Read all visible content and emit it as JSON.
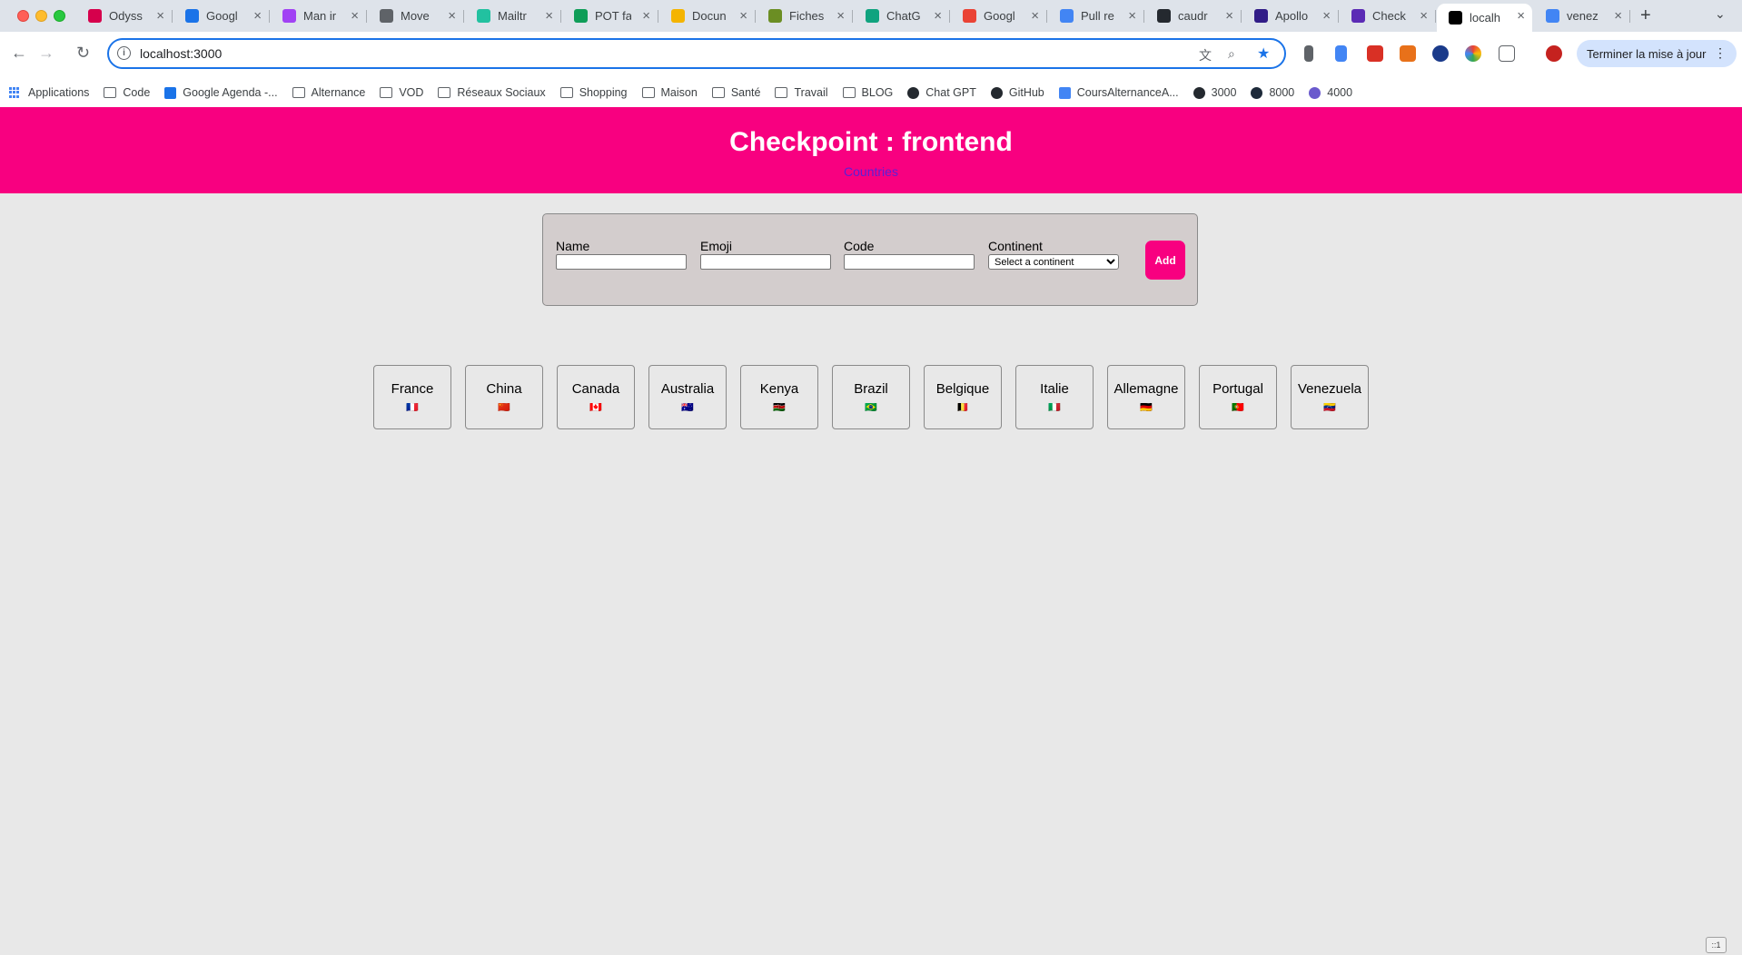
{
  "browser": {
    "tabs": [
      {
        "title": "Odyss",
        "favicon_color": "#d6004c"
      },
      {
        "title": "Googl",
        "favicon_color": "#1a73e8"
      },
      {
        "title": "Man ir",
        "favicon_color": "#a142f4"
      },
      {
        "title": "Move",
        "favicon_color": "#5f6368"
      },
      {
        "title": "Mailtr",
        "favicon_color": "#22c1a0"
      },
      {
        "title": "POT fa",
        "favicon_color": "#0f9d58"
      },
      {
        "title": "Docun",
        "favicon_color": "#f4b400"
      },
      {
        "title": "Fiches",
        "favicon_color": "#6b8e23"
      },
      {
        "title": "ChatG",
        "favicon_color": "#10a37f"
      },
      {
        "title": "Googl",
        "favicon_color": "#ea4335"
      },
      {
        "title": "Pull re",
        "favicon_color": "#4285f4"
      },
      {
        "title": "caudr",
        "favicon_color": "#24292f"
      },
      {
        "title": "Apollo",
        "favicon_color": "#311c87"
      },
      {
        "title": "Check",
        "favicon_color": "#5b2bb5"
      },
      {
        "title": "localh",
        "favicon_color": "#000000",
        "active": true
      },
      {
        "title": "venez",
        "favicon_color": "#4285f4"
      }
    ],
    "new_tab": "+",
    "tab_search": "⌄",
    "url": "localhost:3000",
    "update_button": "Terminer la mise à jour",
    "bookmarks": [
      {
        "label": "Applications",
        "icon": "apps-grid-icon"
      },
      {
        "label": "Code",
        "icon": "folder-icon"
      },
      {
        "label": "Google Agenda -...",
        "icon": "calendar-icon"
      },
      {
        "label": "Alternance",
        "icon": "folder-icon"
      },
      {
        "label": "VOD",
        "icon": "folder-icon"
      },
      {
        "label": "Réseaux Sociaux",
        "icon": "folder-icon"
      },
      {
        "label": "Shopping",
        "icon": "folder-icon"
      },
      {
        "label": "Maison",
        "icon": "folder-icon"
      },
      {
        "label": "Santé",
        "icon": "folder-icon"
      },
      {
        "label": "Travail",
        "icon": "folder-icon"
      },
      {
        "label": "BLOG",
        "icon": "folder-icon"
      },
      {
        "label": "Chat GPT",
        "icon": "chatgpt-icon"
      },
      {
        "label": "GitHub",
        "icon": "github-icon"
      },
      {
        "label": "CoursAlternanceA...",
        "icon": "docs-icon"
      },
      {
        "label": "3000",
        "icon": "nextjs-icon"
      },
      {
        "label": "8000",
        "icon": "react-icon"
      },
      {
        "label": "4000",
        "icon": "apollo-icon"
      }
    ]
  },
  "page": {
    "title": "Checkpoint : frontend",
    "nav_link": "Countries",
    "form": {
      "name_label": "Name",
      "name_value": "",
      "emoji_label": "Emoji",
      "emoji_value": "",
      "code_label": "Code",
      "code_value": "",
      "continent_label": "Continent",
      "continent_selected": "Select a continent",
      "add_button": "Add"
    },
    "countries": [
      {
        "name": "France",
        "flag": "🇫🇷"
      },
      {
        "name": "China",
        "flag": "🇨🇳"
      },
      {
        "name": "Canada",
        "flag": "🇨🇦"
      },
      {
        "name": "Australia",
        "flag": "🇦🇺"
      },
      {
        "name": "Kenya",
        "flag": "🇰🇪"
      },
      {
        "name": "Brazil",
        "flag": "🇧🇷"
      },
      {
        "name": "Belgique",
        "flag": "🇧🇪"
      },
      {
        "name": "Italie",
        "flag": "🇮🇹"
      },
      {
        "name": "Allemagne",
        "flag": "🇩🇪"
      },
      {
        "name": "Portugal",
        "flag": "🇵🇹"
      },
      {
        "name": "Venezuela",
        "flag": "🇻🇪"
      }
    ],
    "colors": {
      "brand_pink": "#f80080",
      "link_purple": "#5b1fd6",
      "page_bg": "#e8e8e8",
      "form_bg": "#d3cdcd"
    }
  },
  "corner_badge": "::1"
}
